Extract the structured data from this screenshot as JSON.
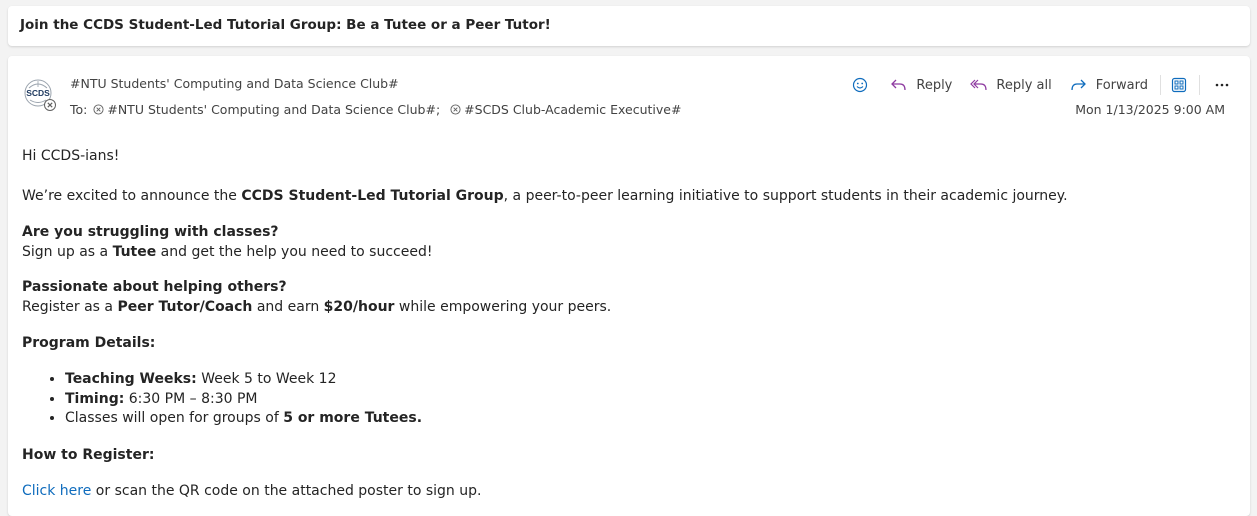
{
  "subject": "Join the CCDS Student-Led Tutorial Group: Be a Tutee or a Peer Tutor!",
  "header": {
    "avatar_text": "SCDS",
    "sender": "#NTU Students' Computing and Data Science Club#",
    "to_label": "To:",
    "recipients": [
      "#NTU Students' Computing and Data Science Club#;",
      "#SCDS Club-Academic Executive#"
    ],
    "date": "Mon 1/13/2025 9:00 AM"
  },
  "actions": {
    "reply": "Reply",
    "reply_all": "Reply all",
    "forward": "Forward"
  },
  "icons": {
    "emoji": "smiley-icon",
    "reply": "reply-icon",
    "reply_all": "reply-all-icon",
    "forward": "forward-icon",
    "apps": "apps-grid-icon",
    "more": "more-icon"
  },
  "colors": {
    "accent": "#0f6cbd",
    "reply_all_icon": "#8e3ba1"
  },
  "body": {
    "greeting": "Hi CCDS-ians!",
    "intro_pre": "We’re excited to announce the ",
    "intro_bold": "CCDS Student-Led Tutorial Group",
    "intro_post": ", a peer-to-peer learning initiative to support students in their academic journey.",
    "q1": "Are you struggling with classes?",
    "q1_pre": "Sign up as a ",
    "q1_bold": "Tutee",
    "q1_post": " and get the help you need to succeed!",
    "q2": "Passionate about helping others?",
    "q2_pre": "Register as a ",
    "q2_bold1": "Peer Tutor/Coach",
    "q2_mid": " and earn ",
    "q2_bold2": "$20/hour",
    "q2_post": " while empowering your peers.",
    "details_heading": "Program Details:",
    "detail1_label": "Teaching Weeks:",
    "detail1_value": " Week 5 to Week 12",
    "detail2_label": "Timing:",
    "detail2_value": " 6:30 PM – 8:30 PM",
    "detail3_pre": "Classes will open for groups of ",
    "detail3_bold": "5 or more Tutees.",
    "register_heading": "How to Register:",
    "register_link": "Click here",
    "register_post": " or scan the QR code on the attached poster to sign up."
  }
}
